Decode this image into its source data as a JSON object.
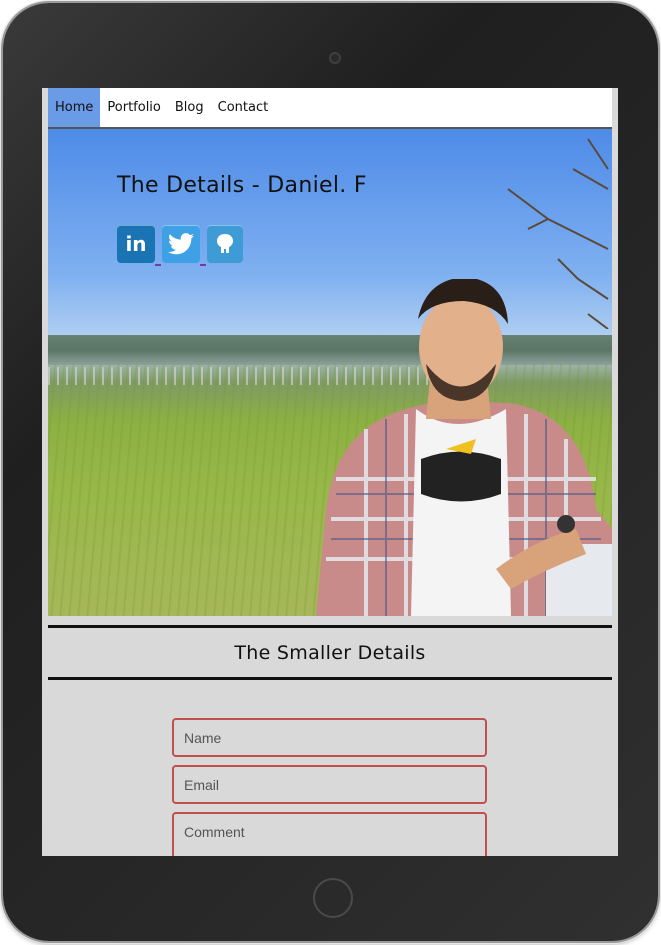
{
  "nav": {
    "items": [
      {
        "label": "Home",
        "active": true
      },
      {
        "label": "Portfolio",
        "active": false
      },
      {
        "label": "Blog",
        "active": false
      },
      {
        "label": "Contact",
        "active": false
      }
    ]
  },
  "hero": {
    "title": "The Details - Daniel. F",
    "social": [
      {
        "icon": "linkedin-icon",
        "glyph": "in"
      },
      {
        "icon": "twitter-icon",
        "glyph": ""
      },
      {
        "icon": "github-icon",
        "glyph": ""
      }
    ]
  },
  "details": {
    "title": "The Smaller Details"
  },
  "form": {
    "name_placeholder": "Name",
    "email_placeholder": "Email",
    "comment_placeholder": "Comment"
  },
  "colors": {
    "nav_active": "#6a9be6",
    "field_border": "#c0504d",
    "page_bg": "#d9d9d9"
  }
}
